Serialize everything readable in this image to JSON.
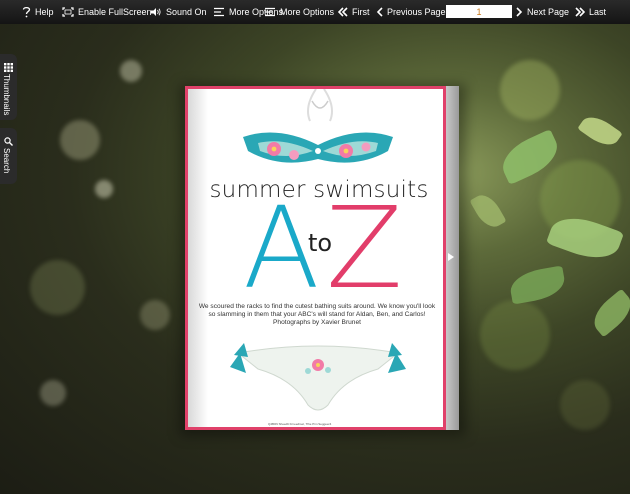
{
  "toolbar": {
    "help_label": "Help",
    "fullscreen_label": "Enable FullScreen",
    "sound_label": "Sound On",
    "more_options_label_1": "More Options",
    "more_options_label_2": "More Options",
    "first_label": "First",
    "previous_label": "Previous Page",
    "page_value": "1",
    "next_label": "Next Page",
    "last_label": "Last"
  },
  "side_tabs": {
    "thumbnails_label": "Thumbnails",
    "search_label": "Search"
  },
  "magazine": {
    "title": "summer swimsuits",
    "letter_a": "A",
    "letter_to": "to",
    "letter_z": "Z",
    "intro": "We scoured the racks to find the cutest bathing suits around. We know you'll look so slamming in them that your ABC's will stand for Aldan, Ben, and Carlos! Photographs by Xavier Brunet",
    "footer": "Q4B0N Sheedlt Frneedrsel, Tlhe Pim Seggeer4"
  },
  "colors": {
    "toolbar_bg": "#1d1d1d",
    "page_border": "#e0416a",
    "accent_blue": "#1aa9c9",
    "accent_pink": "#e23d6a"
  }
}
